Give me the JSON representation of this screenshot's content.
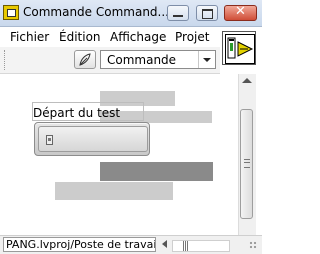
{
  "window": {
    "title": "Commande Command..."
  },
  "menubar": {
    "items": [
      "Fichier",
      "Édition",
      "Affichage",
      "Projet"
    ]
  },
  "toolbar": {
    "mode_select": "Commande"
  },
  "panel": {
    "boolean_control": {
      "label": "Départ du test"
    }
  },
  "statusbar": {
    "project_path": "PANG.lvproj/Poste de travail"
  },
  "colors": {
    "placeholder_bar": "#cccccc",
    "dark_bar": "#8a8a8a",
    "window_close": "#cf4d37"
  }
}
